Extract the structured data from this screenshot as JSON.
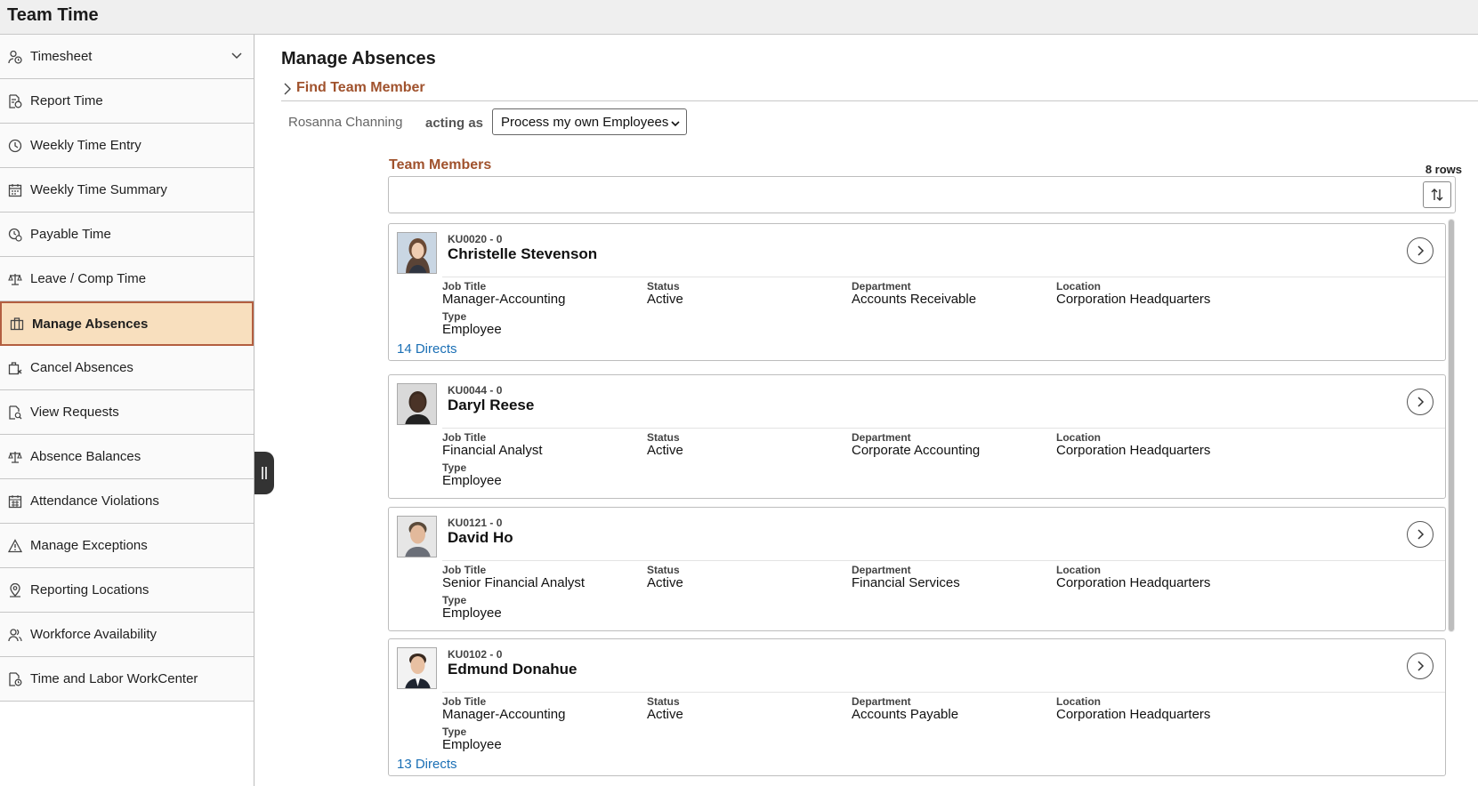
{
  "app": {
    "title": "Team Time"
  },
  "sidebar": {
    "items": [
      {
        "label": "Timesheet",
        "icon": "person-clock-icon"
      },
      {
        "label": "Report Time",
        "icon": "report-time-icon"
      },
      {
        "label": "Weekly Time Entry",
        "icon": "clock-icon"
      },
      {
        "label": "Weekly Time Summary",
        "icon": "calendar-icon"
      },
      {
        "label": "Payable Time",
        "icon": "money-clock-icon"
      },
      {
        "label": "Leave / Comp Time",
        "icon": "scales-icon"
      },
      {
        "label": "Manage Absences",
        "icon": "briefcase-icon"
      },
      {
        "label": "Cancel Absences",
        "icon": "cancel-briefcase-icon"
      },
      {
        "label": "View Requests",
        "icon": "document-search-icon"
      },
      {
        "label": "Absence Balances",
        "icon": "scales-icon"
      },
      {
        "label": "Attendance Violations",
        "icon": "calendar-grid-icon"
      },
      {
        "label": "Manage Exceptions",
        "icon": "warning-icon"
      },
      {
        "label": "Reporting Locations",
        "icon": "location-pin-icon"
      },
      {
        "label": "Workforce Availability",
        "icon": "people-icon"
      },
      {
        "label": "Time and Labor WorkCenter",
        "icon": "document-clock-icon"
      }
    ],
    "active_index": 6
  },
  "main": {
    "page_title": "Manage Absences",
    "find_team_member": "Find Team Member",
    "user_name": "Rosanna Channing",
    "acting_as_label": "acting as",
    "acting_as_value": "Process my own Employees",
    "grid_title": "Team Members",
    "row_count": "8 rows"
  },
  "labels": {
    "job_title": "Job Title",
    "status": "Status",
    "department": "Department",
    "location": "Location",
    "type": "Type"
  },
  "employees": [
    {
      "id": "KU0020 - 0",
      "name": "Christelle Stevenson",
      "job_title": "Manager-Accounting",
      "status": "Active",
      "department": "Accounts Receivable",
      "location": "Corporation Headquarters",
      "type": "Employee",
      "directs": "14 Directs"
    },
    {
      "id": "KU0044 - 0",
      "name": "Daryl Reese",
      "job_title": "Financial Analyst",
      "status": "Active",
      "department": "Corporate Accounting",
      "location": "Corporation Headquarters",
      "type": "Employee",
      "directs": ""
    },
    {
      "id": "KU0121 - 0",
      "name": "David Ho",
      "job_title": "Senior Financial Analyst",
      "status": "Active",
      "department": "Financial Services",
      "location": "Corporation Headquarters",
      "type": "Employee",
      "directs": ""
    },
    {
      "id": "KU0102 - 0",
      "name": "Edmund Donahue",
      "job_title": "Manager-Accounting",
      "status": "Active",
      "department": "Accounts Payable",
      "location": "Corporation Headquarters",
      "type": "Employee",
      "directs": "13 Directs"
    }
  ],
  "colors": {
    "accent": "#a0522d",
    "active_bg": "#f8dfbe",
    "active_border": "#b35e40",
    "link": "#1a6fb5"
  }
}
